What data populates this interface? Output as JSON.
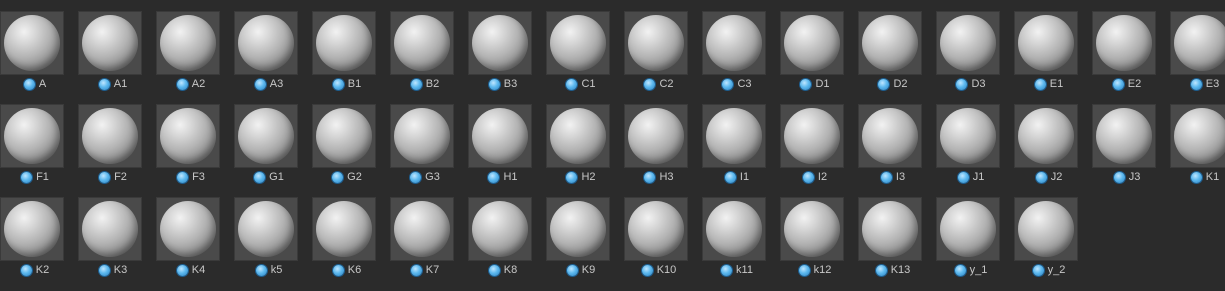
{
  "materials": [
    {
      "name": "A"
    },
    {
      "name": "A1"
    },
    {
      "name": "A2"
    },
    {
      "name": "A3"
    },
    {
      "name": "B1"
    },
    {
      "name": "B2"
    },
    {
      "name": "B3"
    },
    {
      "name": "C1"
    },
    {
      "name": "C2"
    },
    {
      "name": "C3"
    },
    {
      "name": "D1"
    },
    {
      "name": "D2"
    },
    {
      "name": "D3"
    },
    {
      "name": "E1"
    },
    {
      "name": "E2"
    },
    {
      "name": "E3"
    },
    {
      "name": "F1"
    },
    {
      "name": "F2"
    },
    {
      "name": "F3"
    },
    {
      "name": "G1"
    },
    {
      "name": "G2"
    },
    {
      "name": "G3"
    },
    {
      "name": "H1"
    },
    {
      "name": "H2"
    },
    {
      "name": "H3"
    },
    {
      "name": "I1"
    },
    {
      "name": "I2"
    },
    {
      "name": "I3"
    },
    {
      "name": "J1"
    },
    {
      "name": "J2"
    },
    {
      "name": "J3"
    },
    {
      "name": "K1"
    },
    {
      "name": "K2"
    },
    {
      "name": "K3"
    },
    {
      "name": "K4"
    },
    {
      "name": "k5"
    },
    {
      "name": "K6"
    },
    {
      "name": "K7"
    },
    {
      "name": "K8"
    },
    {
      "name": "K9"
    },
    {
      "name": "K10"
    },
    {
      "name": "k11"
    },
    {
      "name": "k12"
    },
    {
      "name": "K13"
    },
    {
      "name": "y_1"
    },
    {
      "name": "y_2"
    }
  ],
  "icons": {
    "thumbnail": "material-sphere-icon",
    "type": "material-type-icon"
  },
  "colors": {
    "background": "#2b2b2b",
    "label_text": "#c8c8c8",
    "material_icon": "#5cb8ee"
  }
}
